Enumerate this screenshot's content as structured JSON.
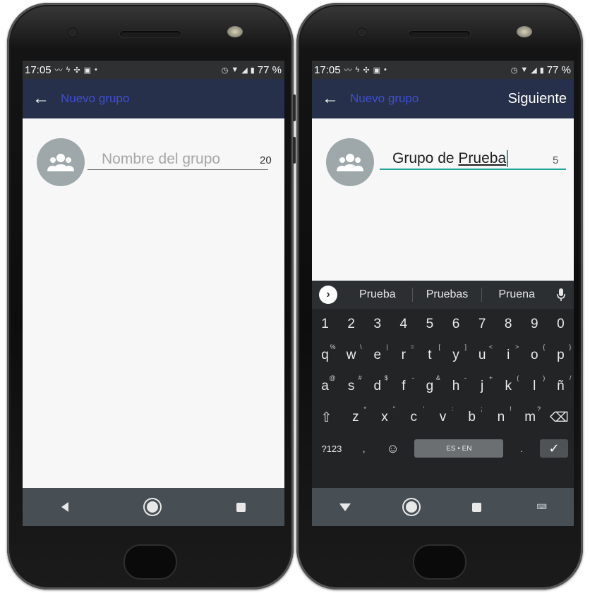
{
  "left_phone": {
    "status": {
      "time": "17:05",
      "battery": "77 %"
    },
    "appbar": {
      "title": "Nuevo grupo"
    },
    "group_name": {
      "placeholder": "Nombre del grupo",
      "remaining": "20"
    }
  },
  "right_phone": {
    "status": {
      "time": "17:05",
      "battery": "77 %"
    },
    "appbar": {
      "title": "Nuevo grupo",
      "next_label": "Siguiente"
    },
    "group_name": {
      "value_prefix": "Grupo de ",
      "value_word": "Prueba",
      "remaining": "5"
    },
    "keyboard": {
      "suggestions": [
        "Prueba",
        "Pruebas",
        "Pruena"
      ],
      "numbers": [
        "1",
        "2",
        "3",
        "4",
        "5",
        "6",
        "7",
        "8",
        "9",
        "0"
      ],
      "row1": [
        {
          "k": "q",
          "s": "%"
        },
        {
          "k": "w",
          "s": "\\"
        },
        {
          "k": "e",
          "s": "|"
        },
        {
          "k": "r",
          "s": "="
        },
        {
          "k": "t",
          "s": "["
        },
        {
          "k": "y",
          "s": "]"
        },
        {
          "k": "u",
          "s": "<"
        },
        {
          "k": "i",
          "s": ">"
        },
        {
          "k": "o",
          "s": "{"
        },
        {
          "k": "p",
          "s": "}"
        }
      ],
      "row2": [
        {
          "k": "a",
          "s": "@"
        },
        {
          "k": "s",
          "s": "#"
        },
        {
          "k": "d",
          "s": "$"
        },
        {
          "k": "f",
          "s": "-"
        },
        {
          "k": "g",
          "s": "&"
        },
        {
          "k": "h",
          "s": "-"
        },
        {
          "k": "j",
          "s": "+"
        },
        {
          "k": "k",
          "s": "("
        },
        {
          "k": "l",
          "s": ")"
        },
        {
          "k": "ñ",
          "s": "/"
        }
      ],
      "row3": [
        {
          "k": "z",
          "s": "*"
        },
        {
          "k": "x",
          "s": "\""
        },
        {
          "k": "c",
          "s": "'"
        },
        {
          "k": "v",
          "s": ":"
        },
        {
          "k": "b",
          "s": ";"
        },
        {
          "k": "n",
          "s": "!"
        },
        {
          "k": "m",
          "s": "?"
        }
      ],
      "symbols_key": "?123",
      "comma_key": ",",
      "space_label": "ES • EN",
      "period_key": ".",
      "enter_key": "✓"
    }
  },
  "colors": {
    "appbar": "#26304a",
    "title_accent": "#3f4fd1",
    "input_focus": "#26a69a",
    "avatar": "#9ea8aa"
  }
}
